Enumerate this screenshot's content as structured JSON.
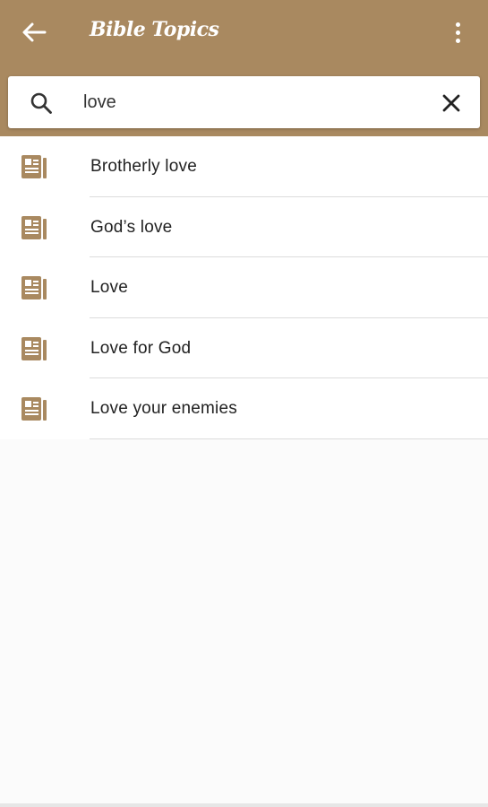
{
  "appbar": {
    "title": "Bible Topics",
    "back_icon": "arrow-left-icon",
    "menu_icon": "more-vertical-icon",
    "color": "#a98960"
  },
  "search": {
    "value": "love",
    "placeholder": "",
    "search_icon": "search-icon",
    "clear_icon": "close-icon"
  },
  "results": [
    {
      "label": "Brotherly love",
      "icon": "book-icon"
    },
    {
      "label": "God’s love",
      "icon": "book-icon"
    },
    {
      "label": "Love",
      "icon": "book-icon"
    },
    {
      "label": "Love for God",
      "icon": "book-icon"
    },
    {
      "label": "Love your enemies",
      "icon": "book-icon"
    }
  ]
}
